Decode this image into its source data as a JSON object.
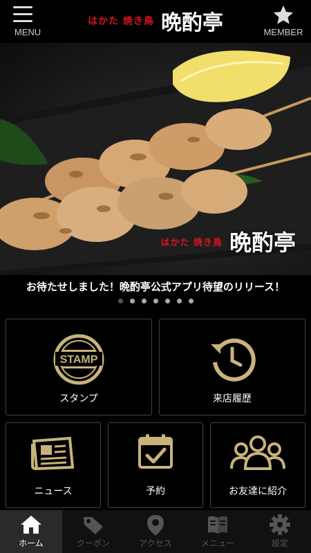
{
  "header": {
    "menu_label": "MENU",
    "member_label": "MEMBER",
    "logo_sub": "はかた 焼き鳥",
    "logo_main": "晩酌亭"
  },
  "hero": {
    "logo_sub": "はかた 焼き鳥",
    "logo_main": "晩酌亭"
  },
  "carousel": {
    "caption": "お待たせしました！晩酌亭公式アプリ待望のリリース！",
    "page_count": 7,
    "active_index": 0
  },
  "tiles": {
    "stamp": {
      "label": "スタンプ",
      "icon": "stamp-icon",
      "icon_text": "STAMP"
    },
    "history": {
      "label": "来店履歴",
      "icon": "history-icon"
    },
    "news": {
      "label": "ニュース",
      "icon": "newspaper-icon"
    },
    "reserve": {
      "label": "予約",
      "icon": "calendar-check-icon"
    },
    "invite": {
      "label": "お友達に紹介",
      "icon": "group-icon"
    }
  },
  "nav": {
    "items": [
      {
        "label": "ホーム",
        "icon": "home-icon",
        "active": true
      },
      {
        "label": "クーポン",
        "icon": "coupon-tag-icon",
        "active": false
      },
      {
        "label": "アクセス",
        "icon": "map-pin-icon",
        "active": false
      },
      {
        "label": "メニュー",
        "icon": "book-icon",
        "active": false
      },
      {
        "label": "設定",
        "icon": "gear-icon",
        "active": false
      }
    ]
  },
  "colors": {
    "accent_gold": "#c9b37a",
    "logo_red": "#d4141c",
    "tile_border": "#444444"
  }
}
